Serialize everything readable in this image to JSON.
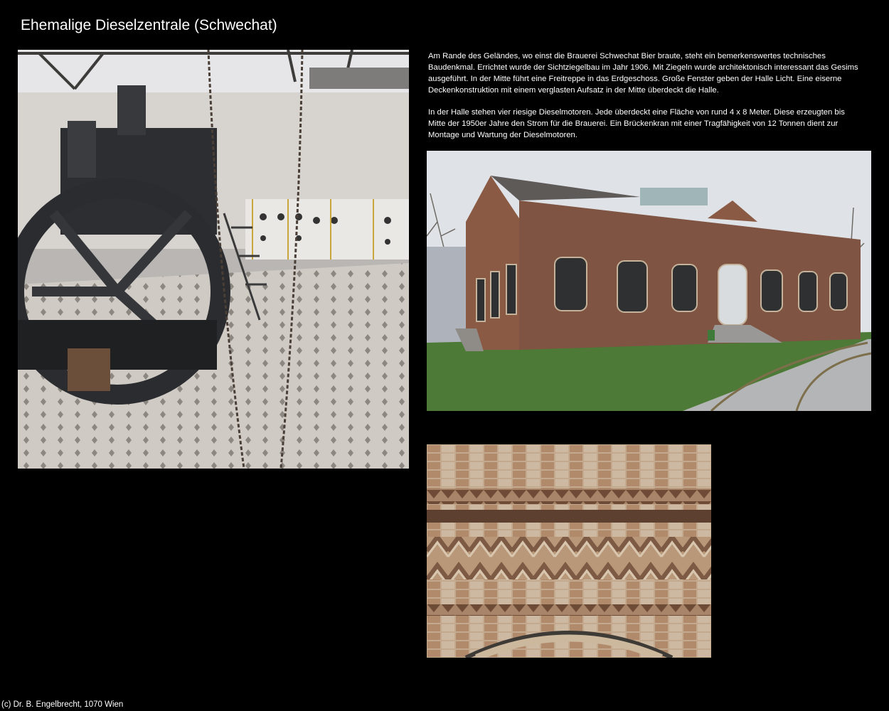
{
  "page": {
    "title": "Ehemalige Dieselzentrale (Schwechat)",
    "footer": "(c) Dr. B. Engelbrecht, 1070 Wien"
  },
  "text": {
    "paragraph1": "Am Rande des Geländes, wo einst die Brauerei Schwechat Bier braute, steht ein bemerkenswertes technisches Baudenkmal. Errichtet wurde der Sichtziegelbau im Jahr 1906. Mit Ziegeln wurde architektonisch interessant das Gesims ausgeführt. In der Mitte führt eine Freitreppe in das Erdgeschoss. Große Fenster geben der Halle Licht. Eine eiserne Deckenkonstruktion mit einem verglasten Aufsatz in der Mitte überdeckt die Halle.",
    "paragraph2": "In der Halle stehen vier riesige Dieselmotoren. Jede überdeckt eine Fläche von rund 4 x 8 Meter. Diese erzeugten bis Mitte der 1950er Jahre den Strom für die Brauerei. Ein Brückenkran mit einer Tragfähigkeit von 12 Tonnen dient zur Montage und Wartung der Dieselmotoren."
  },
  "colors": {
    "background": "#000000",
    "text": "#ffffff",
    "brick": "#8a5a44",
    "floor": "#c9c3bd"
  }
}
